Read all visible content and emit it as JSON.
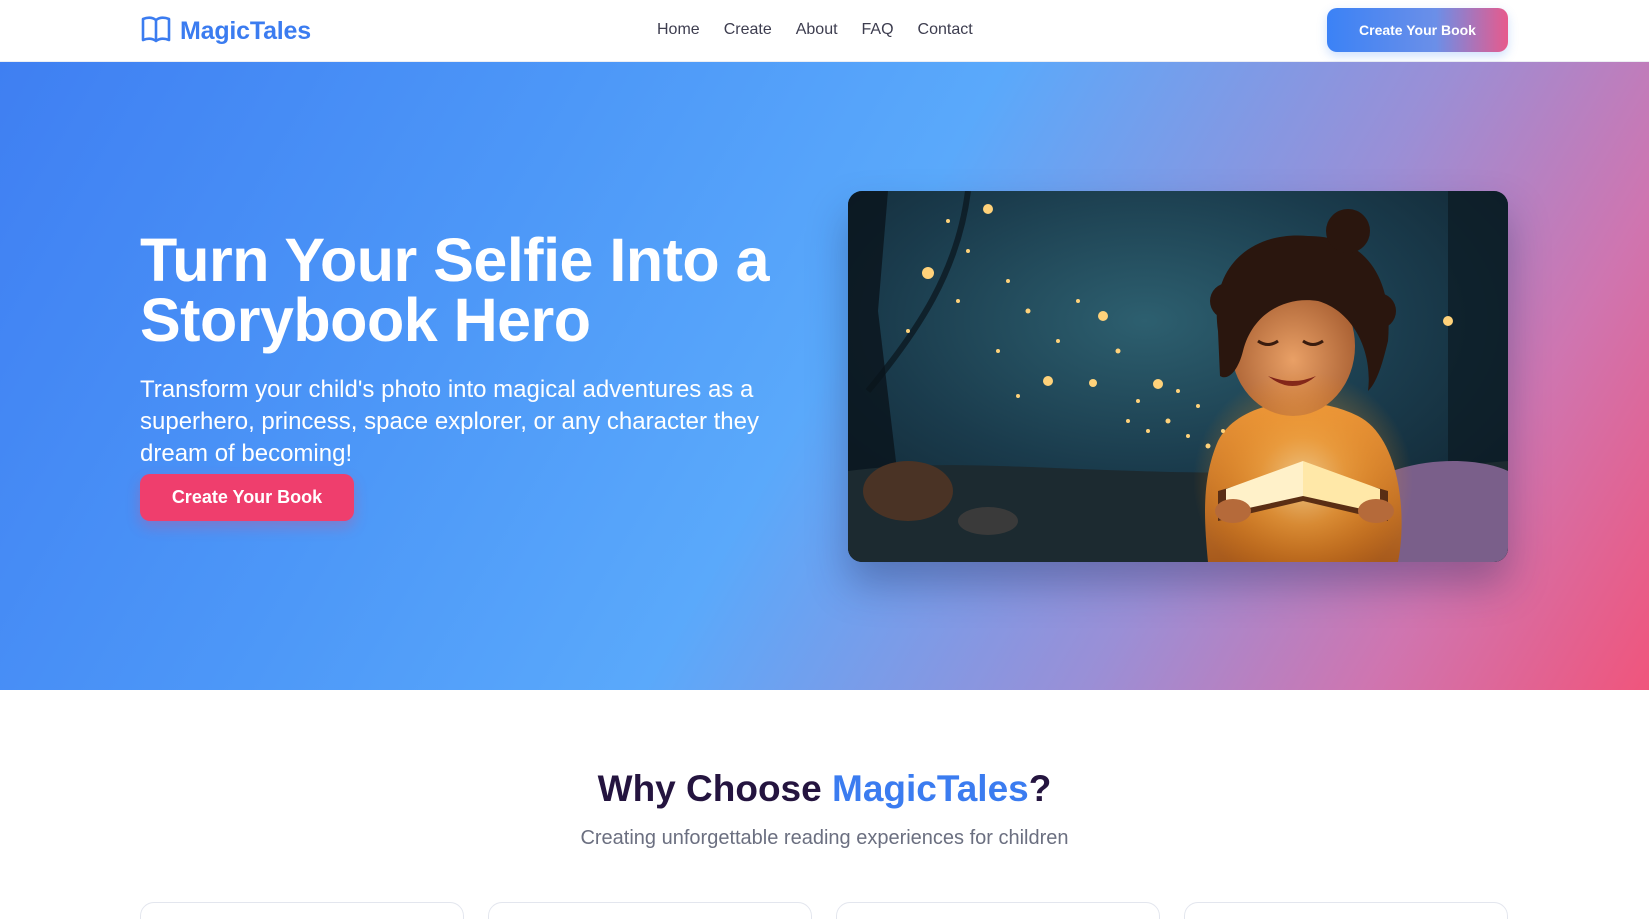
{
  "header": {
    "logo_text": "MagicTales",
    "logo_icon": "open-book-icon",
    "nav": [
      "Home",
      "Create",
      "About",
      "FAQ",
      "Contact"
    ],
    "cta_label": "Create Your Book"
  },
  "hero": {
    "title": "Turn Your Selfie Into a Storybook Hero",
    "subtitle": "Transform your child's photo into magical adventures as a superhero, princess, space explorer, or any character they dream of becoming!",
    "cta_label": "Create Your Book",
    "image_alt": "Child reading a glowing magical book in an enchanted forest"
  },
  "why": {
    "title_prefix": "Why Choose ",
    "title_accent": "MagicTales",
    "title_suffix": "?",
    "subtitle": "Creating unforgettable reading experiences for children"
  },
  "colors": {
    "brand": "#3b7cf0",
    "cta_pink": "#ef3e6d",
    "heading_dark": "#24143f"
  }
}
